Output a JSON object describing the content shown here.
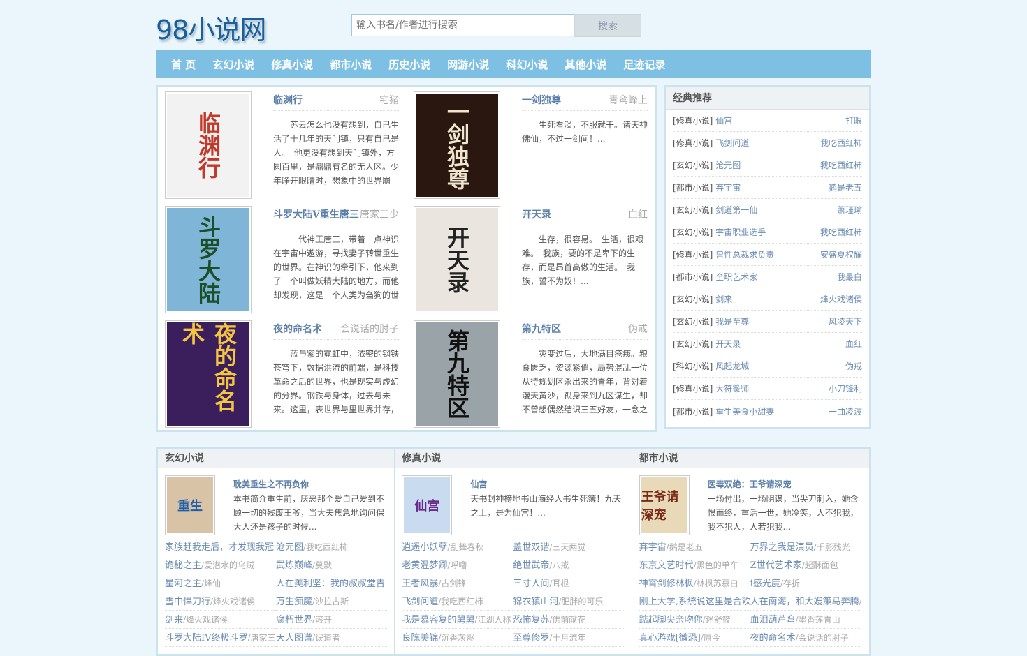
{
  "site": {
    "logo": "98小说网"
  },
  "search": {
    "placeholder": "输入书名/作者进行搜索",
    "button": "搜索"
  },
  "nav": [
    "首 页",
    "玄幻小说",
    "修真小说",
    "都市小说",
    "历史小说",
    "网游小说",
    "科幻小说",
    "其他小说",
    "足迹记录"
  ],
  "featured": [
    {
      "title": "临渊行",
      "author": "宅猪",
      "desc": "苏云怎么也没有想到，自己生活了十几年的天门镇，只有自己是人。　他更没有想到天门镇外，方圆百里，是鼎鼎有名的无人区。少年睁开眼睛时，想象中的世界崩",
      "cover_text": "临渊行",
      "cover_bg": "#f2f2f2",
      "cover_fg": "#c0392b"
    },
    {
      "title": "一剑独尊",
      "author": "青鸾峰上",
      "desc": "生死看淡，不服就干。诸天神佛仙，不过一剑间！...",
      "cover_text": "一剑独尊",
      "cover_bg": "#2a1710",
      "cover_fg": "#f0e6d0"
    },
    {
      "title": "斗罗大陆V重生唐三",
      "author": "唐家三少",
      "desc": "一代神王唐三，带着一点神识在宇宙中遨游，寻找妻子转世重生的世界。在神识的牵引下，他来到了一个叫做妖精大陆的地方，而他却发现，这是一个人类为刍狗的世",
      "cover_text": "斗罗大陆",
      "cover_bg": "#7fb5d6",
      "cover_fg": "#1b4f2a"
    },
    {
      "title": "开天录",
      "author": "血红",
      "desc": "生存，很容易。　生活，很艰难。　我族，要的不是卑下的生存，而是昂首高傲的生活。　我族，誓不为奴！...",
      "cover_text": "开天录",
      "cover_bg": "#eae6df",
      "cover_fg": "#222"
    },
    {
      "title": "夜的命名术",
      "author": "会说话的肘子",
      "desc": "蓝与紫的霓虹中，浓密的钢铁苍穹下，数据洪流的前端，是科技革命之后的世界，也是现实与虚幻的分界。钢铁与身体，过去与未来。这里，表世界与里世界并存，",
      "cover_text": "夜的命名术",
      "cover_bg": "#3a1f5c",
      "cover_fg": "#f4c542"
    },
    {
      "title": "第九特区",
      "author": "伪戒",
      "desc": "灾变过后，大地满目疮痍。粮食匮乏，资源紧俏，局势混乱一位从待规划区杀出来的青年，背对着漫天黄沙，孤身来到九区谋生，却不曾想偶然结识三五好友，一念之",
      "cover_text": "第九特区",
      "cover_bg": "#9aa3a8",
      "cover_fg": "#111"
    }
  ],
  "recommend": {
    "heading": "经典推荐",
    "items": [
      {
        "cat": "[修真小说]",
        "name": "仙宫",
        "author": "打眼"
      },
      {
        "cat": "[修真小说]",
        "name": "飞剑问道",
        "author": "我吃西红柿"
      },
      {
        "cat": "[玄幻小说]",
        "name": "沧元图",
        "author": "我吃西红柿"
      },
      {
        "cat": "[都市小说]",
        "name": "弃宇宙",
        "author": "鹅是老五"
      },
      {
        "cat": "[玄幻小说]",
        "name": "剑道第一仙",
        "author": "萧瑾瑜"
      },
      {
        "cat": "[玄幻小说]",
        "name": "宇宙职业选手",
        "author": "我吃西红柿"
      },
      {
        "cat": "[修真小说]",
        "name": "兽性总裁求负责",
        "author": "安盛夏权耀"
      },
      {
        "cat": "[都市小说]",
        "name": "全职艺术家",
        "author": "我最白"
      },
      {
        "cat": "[玄幻小说]",
        "name": "剑来",
        "author": "烽火戏诸侯"
      },
      {
        "cat": "[玄幻小说]",
        "name": "我是至尊",
        "author": "风凌天下"
      },
      {
        "cat": "[玄幻小说]",
        "name": "开天录",
        "author": "血红"
      },
      {
        "cat": "[科幻小说]",
        "name": "风起龙城",
        "author": "伪戒"
      },
      {
        "cat": "[修真小说]",
        "name": "大符篆师",
        "author": "小刀锋利"
      },
      {
        "cat": "[都市小说]",
        "name": "重生美食小甜妻",
        "author": "一曲凌波"
      }
    ]
  },
  "categories": [
    {
      "heading": "玄幻小说",
      "feature": {
        "title": "耽美重生之不再负你",
        "desc": "本书简介重生前，厌恶那个爱自己爱到不顾一切的残废王爷，当大夫焦急地询问保大人还是孩子的时候...",
        "cover_text": "重生",
        "cover_bg": "#d9c3a7",
        "cover_fg": "#1e5fa8"
      },
      "list": [
        {
          "n": "家族赶我走后，才发现我冠",
          "a": ""
        },
        {
          "n": "沧元图",
          "a": "/我吃西红柿"
        },
        {
          "n": "诡秘之主",
          "a": "/爱潜水的乌贼"
        },
        {
          "n": "武炼巅峰",
          "a": "/莫默"
        },
        {
          "n": "星河之主",
          "a": "/烽仙"
        },
        {
          "n": "人在美利坚：我的叔叔堂吉",
          "a": ""
        },
        {
          "n": "雪中悍刀行",
          "a": "/烽火戏诸侯"
        },
        {
          "n": "万生痴魔",
          "a": "/沙拉古斯"
        },
        {
          "n": "剑来",
          "a": "/烽火戏诸侯"
        },
        {
          "n": "腐朽世界",
          "a": "/滚开"
        },
        {
          "n": "斗罗大陆IV终极斗罗",
          "a": "/唐家三少"
        },
        {
          "n": "天人图谱",
          "a": "/误道者"
        }
      ]
    },
    {
      "heading": "修真小说",
      "feature": {
        "title": "仙宫",
        "desc": "天书封神榜地书山海经人书生死簿！九天之上，是为仙宫！...",
        "cover_text": "仙宫",
        "cover_bg": "#c9dcef",
        "cover_fg": "#6a2a8a"
      },
      "list": [
        {
          "n": "逍遥小妖孽",
          "a": "/乱舞春秋"
        },
        {
          "n": "盖世双谐",
          "a": "/三天两觉"
        },
        {
          "n": "老黄温梦卿",
          "a": "/呼噜"
        },
        {
          "n": "绝世武帝",
          "a": "/八戒"
        },
        {
          "n": "王者风暴",
          "a": "/古剑锋"
        },
        {
          "n": "三寸人间",
          "a": "/耳根"
        },
        {
          "n": "飞剑问道",
          "a": "/我吃西红柿"
        },
        {
          "n": "锦衣镇山河",
          "a": "/肥胖的可乐"
        },
        {
          "n": "我是慕容复的舅舅",
          "a": "/江湖人称"
        },
        {
          "n": "恐怖复苏",
          "a": "/佛前献花"
        },
        {
          "n": "良陈美锦",
          "a": "/沉香灰烬"
        },
        {
          "n": "至尊修罗",
          "a": "/十月流年"
        }
      ]
    },
    {
      "heading": "都市小说",
      "feature": {
        "title": "医毒双绝：王爷请深宠",
        "desc": "一场付出，一场阴谋，当尖刀刺入，她含恨而终，重活一世，她冷笑，人不犯我，我不犯人，人若犯我...",
        "cover_text": "王爷请深宠",
        "cover_bg": "#e8d9b8",
        "cover_fg": "#7a2a1a"
      },
      "list": [
        {
          "n": "弃宇宙",
          "a": "/鹅是老五"
        },
        {
          "n": "万界之我是演员",
          "a": "/千影残光"
        },
        {
          "n": "东京文艺时代",
          "a": "/黑色的单车"
        },
        {
          "n": "Z世代艺术家",
          "a": "/起酥面包"
        },
        {
          "n": "神霄剑修林枫",
          "a": "/林枫苏慕白"
        },
        {
          "n": "i感光度",
          "a": "/存折"
        },
        {
          "n": "刚上大学,系统说这里是合欢",
          "a": ""
        },
        {
          "n": "人在南海，和大嫂策马奔腾",
          "a": "/"
        },
        {
          "n": "踮起脚尖亲吻你",
          "a": "/迷舒筱"
        },
        {
          "n": "血泪葫芦弯",
          "a": "/墨香莲青山"
        },
        {
          "n": "真心游戏[微恐]",
          "a": "/原今"
        },
        {
          "n": "夜的命名术",
          "a": "/会说话的肘子"
        }
      ]
    }
  ]
}
